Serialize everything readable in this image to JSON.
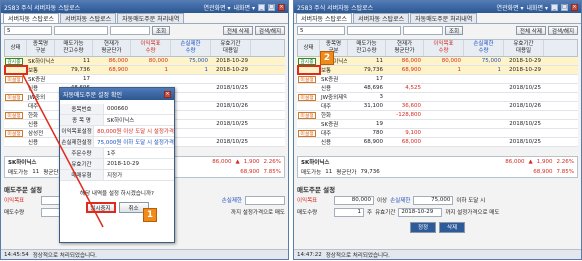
{
  "window_title": "2583 주식 서버자동 스탑로스",
  "title_menu": "연관화면 ▾",
  "title_help": "내화면 ▾",
  "tabs": [
    "서버자동 스탑로스",
    "서버자동 스탑로스",
    "자동매도주문 처리내역"
  ],
  "toolbar": {
    "account_value": "5",
    "search_btn": "조회",
    "view_all_btn": "전체 삭제",
    "search_cancel_btn": "검색/해지"
  },
  "columns": [
    [
      "상태"
    ],
    [
      "종목명",
      "구분"
    ],
    [
      "매도가능",
      "잔고수량"
    ],
    [
      "현재가",
      "평균단가"
    ],
    [
      "이익목표",
      "수량"
    ],
    [
      "손실제한",
      "수량"
    ],
    [
      "유효기간",
      "대용일"
    ]
  ],
  "rows": [
    {
      "status": "감시중",
      "name": "SK하이닉스",
      "qty": "11",
      "price": "86,000",
      "profit": "80,000",
      "loss": "75,000",
      "date": "2018-10-29"
    },
    {
      "status": "",
      "name": "보통",
      "qty": "79,736",
      "price": "68,900",
      "profit": "1",
      "loss": "1",
      "date": "2018-10-29"
    },
    {
      "status": "미설정",
      "name": "SK증권",
      "qty": "17",
      "price": "",
      "profit": "",
      "loss": "",
      "date": ""
    },
    {
      "status": "",
      "name": "신용",
      "qty": "48,696",
      "price": "",
      "profit": "",
      "loss": "",
      "date": "2018/10/25"
    },
    {
      "status": "미설정",
      "name": "JW중외",
      "qty": "",
      "price": "",
      "profit": "",
      "loss": "",
      "date": ""
    },
    {
      "status": "",
      "name": "대주",
      "qty": "",
      "price": "",
      "profit": "",
      "loss": "",
      "date": "2018/10/26"
    },
    {
      "status": "미설정",
      "name": "한화",
      "qty": "",
      "price": "",
      "profit": "",
      "loss": "",
      "date": ""
    },
    {
      "status": "",
      "name": "신용",
      "qty": "",
      "price": "",
      "profit": "",
      "loss": "",
      "date": "2018/10/25"
    },
    {
      "status": "미설정",
      "name": "삼성전",
      "qty": "",
      "price": "",
      "profit": "",
      "loss": "",
      "date": ""
    },
    {
      "status": "",
      "name": "신용",
      "qty": "",
      "price": "",
      "profit": "",
      "loss": "",
      "date": "2018/10/25"
    }
  ],
  "rows2": [
    {
      "status": "감시중",
      "name": "SK하이닉스",
      "qty": "11",
      "price": "86,000",
      "profit": "80,000",
      "loss": "75,000",
      "date": "2018-10-29"
    },
    {
      "status": "",
      "name": "보통",
      "qty": "79,736",
      "price": "68,900",
      "profit": "1",
      "loss": "1",
      "date": "2018-10-29"
    },
    {
      "status": "미설정",
      "name": "SK증권",
      "qty": "17",
      "price": "",
      "profit": "",
      "loss": "",
      "date": ""
    },
    {
      "status": "",
      "name": "신용",
      "qty": "48,696",
      "price": "4,525",
      "profit": "",
      "loss": "",
      "date": "2018/10/25"
    },
    {
      "status": "미설정",
      "name": "JW중외제약",
      "qty": "3",
      "price": "",
      "profit": "",
      "loss": "",
      "date": ""
    },
    {
      "status": "",
      "name": "대주",
      "qty": "31,100",
      "price": "36,600",
      "profit": "",
      "loss": "",
      "date": "2018/10/26"
    },
    {
      "status": "미설정",
      "name": "한화",
      "qty": "",
      "price": "-128,800",
      "profit": "",
      "loss": "",
      "date": ""
    },
    {
      "status": "",
      "name": "SK증권",
      "qty": "19",
      "price": "",
      "profit": "",
      "loss": "",
      "date": "2018/10/25"
    },
    {
      "status": "미설정",
      "name": "대주",
      "qty": "780",
      "price": "9,100",
      "profit": "",
      "loss": "",
      "date": ""
    },
    {
      "status": "",
      "name": "신용",
      "qty": "68,900",
      "price": "68,000",
      "profit": "",
      "loss": "",
      "date": "2018/10/25"
    }
  ],
  "summary": {
    "name": "SK하이닉스",
    "price": "86,000",
    "change_arrow": "▲",
    "change": "1,900",
    "change_pct": "2.26%",
    "sell_label": "매도가능",
    "sell_qty": "11",
    "avg_label": "평균단가",
    "avg": "79,736",
    "pnl_label": "평가손익",
    "pnl": "68,900",
    "rate": "7.85%"
  },
  "setting": {
    "title": "매도주문 설정",
    "profit_label": "이익목표",
    "profit_value": "80,000",
    "profit_unit": "이상",
    "loss_label": "손실제한",
    "loss_value": "75,000",
    "loss_unit": "이하 도달 시",
    "qty_label": "매도수량",
    "qty_value": "1",
    "qty_unit": "주",
    "valid_label": "유효기간",
    "valid_value": "2018-10-29",
    "valid_unit": "까지 설정가격으로 매도",
    "set_btn": "정정",
    "del_btn": "삭제"
  },
  "dialog": {
    "title": "자동매도주문 설정 확인",
    "rows": [
      {
        "k": "종목번호",
        "v": "000660"
      },
      {
        "k": "종 목 명",
        "v": "SK하이닉스"
      },
      {
        "k": "이익목표설정",
        "v": "80,000원 이상 도달 시 설정가격"
      },
      {
        "k": "손실제한설정",
        "v": "75,000원 이하 도달 시 설정가격"
      },
      {
        "k": "주문수량",
        "v": "1주"
      },
      {
        "k": "유효기간",
        "v": "2018-10-29"
      },
      {
        "k": "매매유형",
        "v": "지정가"
      }
    ],
    "message": "해당 내역을 설정 하시겠습니까?",
    "ok": "일시중지",
    "cancel": "취소"
  },
  "status1": {
    "time": "14:45:54",
    "msg": "정상적으로 처리되었습니다."
  },
  "status2": {
    "time": "14:47:22",
    "msg": "정상적으로 처리되었습니다."
  },
  "badges": [
    "1",
    "2"
  ]
}
